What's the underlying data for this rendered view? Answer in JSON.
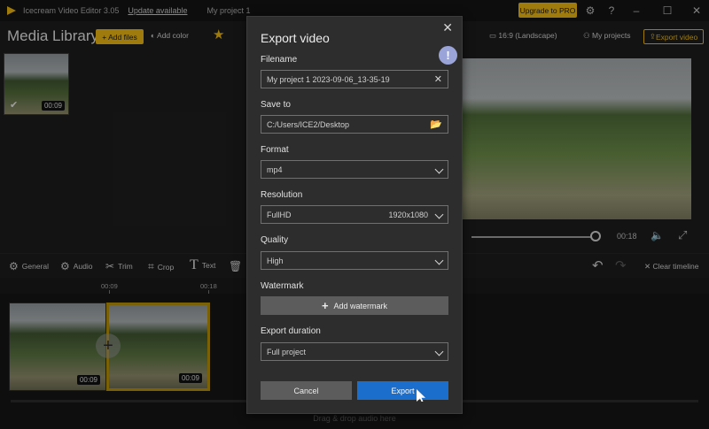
{
  "titlebar": {
    "app_name": "Icecream Video Editor 3.05",
    "update_link": "Update available",
    "project_name": "My project 1",
    "upgrade_label": "Upgrade to PRO",
    "icons": [
      "settings-icon",
      "help-icon",
      "minimize-icon",
      "maximize-icon",
      "close-icon"
    ]
  },
  "toolbar": {
    "media_title": "Media Library",
    "add_files": "+ Add files",
    "add_color": "Add color",
    "aspect_ratio": "16:9 (Landscape)",
    "my_projects": "My projects",
    "export_video": "Export video"
  },
  "library": {
    "items": [
      {
        "duration": "00:09",
        "selected": true
      }
    ]
  },
  "preview": {
    "time": "00:18"
  },
  "edit_tools": {
    "general": "General",
    "audio": "Audio",
    "trim": "Trim",
    "crop": "Crop",
    "text": "Text",
    "clear_timeline": "Clear timeline"
  },
  "timeline": {
    "ticks": [
      "00:09",
      "00:18"
    ],
    "clips": [
      {
        "duration": "00:09"
      },
      {
        "duration": "00:09"
      }
    ],
    "drop_audio": "Drag & drop audio here"
  },
  "export_dialog": {
    "title": "Export video",
    "filename_label": "Filename",
    "filename_value": "My project 1 2023-09-06_13-35-19",
    "save_to_label": "Save to",
    "save_to_value": "C:/Users/ICE2/Desktop",
    "format_label": "Format",
    "format_value": "mp4",
    "resolution_label": "Resolution",
    "resolution_value": "FullHD",
    "resolution_size": "1920x1080",
    "quality_label": "Quality",
    "quality_value": "High",
    "watermark_label": "Watermark",
    "add_watermark": "Add watermark",
    "duration_label": "Export duration",
    "duration_value": "Full project",
    "cancel": "Cancel",
    "export": "Export",
    "info_badge": "!"
  },
  "colors": {
    "accent_yellow": "#e9b512",
    "export_blue": "#1b6ecb",
    "dialog_bg": "#2d2d2d"
  }
}
